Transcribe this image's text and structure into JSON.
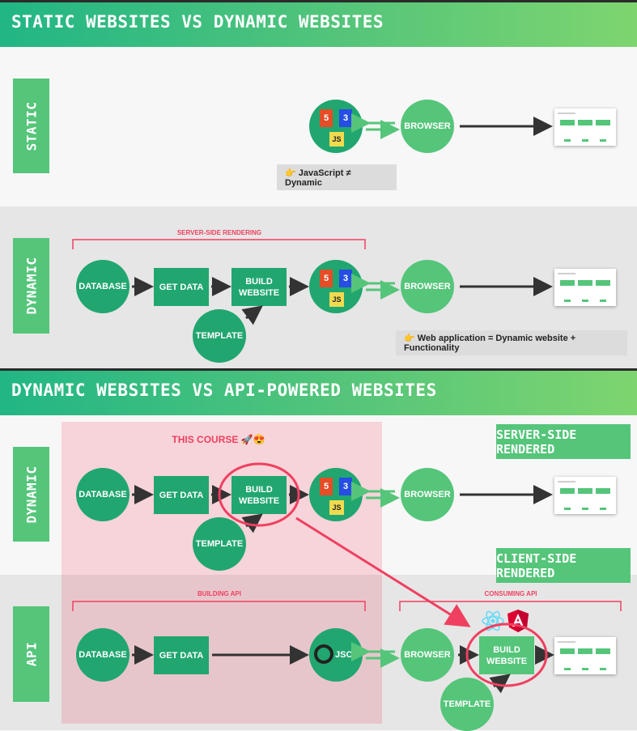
{
  "section1": {
    "title": "STATIC WEBSITES VS DYNAMIC WEBSITES"
  },
  "section2": {
    "title": "DYNAMIC WEBSITES VS API-POWERED WEBSITES"
  },
  "labels": {
    "static": "STATIC",
    "dynamic": "DYNAMIC",
    "dynamic2": "DYNAMIC",
    "api": "API"
  },
  "nodes": {
    "browser": "BROWSER",
    "database": "DATABASE",
    "get_data": "GET DATA",
    "build_website": "BUILD WEBSITE",
    "template": "TEMPLATE",
    "json": "JSON"
  },
  "badges": {
    "html": "HTML",
    "css": "CSS",
    "js": "JS",
    "html_num": "5",
    "css_num": "3"
  },
  "notes": {
    "js_not_dynamic": "👉 JavaScript ≠ Dynamic",
    "web_app": "👉 Web application = Dynamic website + Functionality"
  },
  "annotations": {
    "server_side_rendering": "SERVER-SIDE RENDERING",
    "this_course": "THIS COURSE 🚀😍",
    "server_side_rendered": "SERVER-SIDE RENDERED",
    "client_side_rendered": "CLIENT-SIDE RENDERED",
    "building_api": "BUILDING API",
    "consuming_api": "CONSUMING API"
  },
  "colors": {
    "green_dark": "#21a66f",
    "green_light": "#55c57a",
    "red": "#ef4060",
    "note_bg": "#dcdcdc"
  },
  "icons": [
    "html5-icon",
    "css3-icon",
    "js-icon",
    "react-icon",
    "angular-icon",
    "json-icon",
    "hand-pointing-icon"
  ]
}
